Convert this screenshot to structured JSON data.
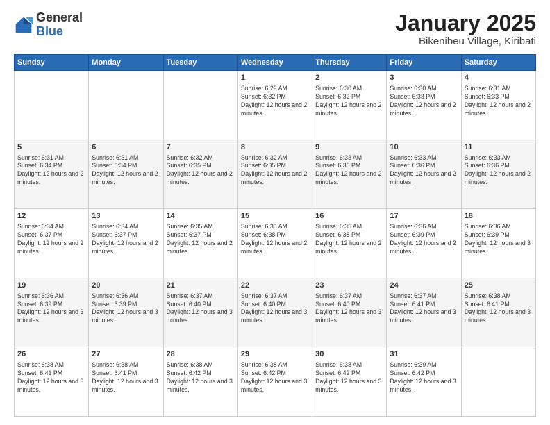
{
  "header": {
    "logo_general": "General",
    "logo_blue": "Blue",
    "month_title": "January 2025",
    "subtitle": "Bikenibeu Village, Kiribati"
  },
  "weekdays": [
    "Sunday",
    "Monday",
    "Tuesday",
    "Wednesday",
    "Thursday",
    "Friday",
    "Saturday"
  ],
  "weeks": [
    [
      {
        "day": "",
        "info": ""
      },
      {
        "day": "",
        "info": ""
      },
      {
        "day": "",
        "info": ""
      },
      {
        "day": "1",
        "info": "Sunrise: 6:29 AM\nSunset: 6:32 PM\nDaylight: 12 hours and 2 minutes."
      },
      {
        "day": "2",
        "info": "Sunrise: 6:30 AM\nSunset: 6:32 PM\nDaylight: 12 hours and 2 minutes."
      },
      {
        "day": "3",
        "info": "Sunrise: 6:30 AM\nSunset: 6:33 PM\nDaylight: 12 hours and 2 minutes."
      },
      {
        "day": "4",
        "info": "Sunrise: 6:31 AM\nSunset: 6:33 PM\nDaylight: 12 hours and 2 minutes."
      }
    ],
    [
      {
        "day": "5",
        "info": "Sunrise: 6:31 AM\nSunset: 6:34 PM\nDaylight: 12 hours and 2 minutes."
      },
      {
        "day": "6",
        "info": "Sunrise: 6:31 AM\nSunset: 6:34 PM\nDaylight: 12 hours and 2 minutes."
      },
      {
        "day": "7",
        "info": "Sunrise: 6:32 AM\nSunset: 6:35 PM\nDaylight: 12 hours and 2 minutes."
      },
      {
        "day": "8",
        "info": "Sunrise: 6:32 AM\nSunset: 6:35 PM\nDaylight: 12 hours and 2 minutes."
      },
      {
        "day": "9",
        "info": "Sunrise: 6:33 AM\nSunset: 6:35 PM\nDaylight: 12 hours and 2 minutes."
      },
      {
        "day": "10",
        "info": "Sunrise: 6:33 AM\nSunset: 6:36 PM\nDaylight: 12 hours and 2 minutes."
      },
      {
        "day": "11",
        "info": "Sunrise: 6:33 AM\nSunset: 6:36 PM\nDaylight: 12 hours and 2 minutes."
      }
    ],
    [
      {
        "day": "12",
        "info": "Sunrise: 6:34 AM\nSunset: 6:37 PM\nDaylight: 12 hours and 2 minutes."
      },
      {
        "day": "13",
        "info": "Sunrise: 6:34 AM\nSunset: 6:37 PM\nDaylight: 12 hours and 2 minutes."
      },
      {
        "day": "14",
        "info": "Sunrise: 6:35 AM\nSunset: 6:37 PM\nDaylight: 12 hours and 2 minutes."
      },
      {
        "day": "15",
        "info": "Sunrise: 6:35 AM\nSunset: 6:38 PM\nDaylight: 12 hours and 2 minutes."
      },
      {
        "day": "16",
        "info": "Sunrise: 6:35 AM\nSunset: 6:38 PM\nDaylight: 12 hours and 2 minutes."
      },
      {
        "day": "17",
        "info": "Sunrise: 6:36 AM\nSunset: 6:39 PM\nDaylight: 12 hours and 2 minutes."
      },
      {
        "day": "18",
        "info": "Sunrise: 6:36 AM\nSunset: 6:39 PM\nDaylight: 12 hours and 3 minutes."
      }
    ],
    [
      {
        "day": "19",
        "info": "Sunrise: 6:36 AM\nSunset: 6:39 PM\nDaylight: 12 hours and 3 minutes."
      },
      {
        "day": "20",
        "info": "Sunrise: 6:36 AM\nSunset: 6:39 PM\nDaylight: 12 hours and 3 minutes."
      },
      {
        "day": "21",
        "info": "Sunrise: 6:37 AM\nSunset: 6:40 PM\nDaylight: 12 hours and 3 minutes."
      },
      {
        "day": "22",
        "info": "Sunrise: 6:37 AM\nSunset: 6:40 PM\nDaylight: 12 hours and 3 minutes."
      },
      {
        "day": "23",
        "info": "Sunrise: 6:37 AM\nSunset: 6:40 PM\nDaylight: 12 hours and 3 minutes."
      },
      {
        "day": "24",
        "info": "Sunrise: 6:37 AM\nSunset: 6:41 PM\nDaylight: 12 hours and 3 minutes."
      },
      {
        "day": "25",
        "info": "Sunrise: 6:38 AM\nSunset: 6:41 PM\nDaylight: 12 hours and 3 minutes."
      }
    ],
    [
      {
        "day": "26",
        "info": "Sunrise: 6:38 AM\nSunset: 6:41 PM\nDaylight: 12 hours and 3 minutes."
      },
      {
        "day": "27",
        "info": "Sunrise: 6:38 AM\nSunset: 6:41 PM\nDaylight: 12 hours and 3 minutes."
      },
      {
        "day": "28",
        "info": "Sunrise: 6:38 AM\nSunset: 6:42 PM\nDaylight: 12 hours and 3 minutes."
      },
      {
        "day": "29",
        "info": "Sunrise: 6:38 AM\nSunset: 6:42 PM\nDaylight: 12 hours and 3 minutes."
      },
      {
        "day": "30",
        "info": "Sunrise: 6:38 AM\nSunset: 6:42 PM\nDaylight: 12 hours and 3 minutes."
      },
      {
        "day": "31",
        "info": "Sunrise: 6:39 AM\nSunset: 6:42 PM\nDaylight: 12 hours and 3 minutes."
      },
      {
        "day": "",
        "info": ""
      }
    ]
  ]
}
